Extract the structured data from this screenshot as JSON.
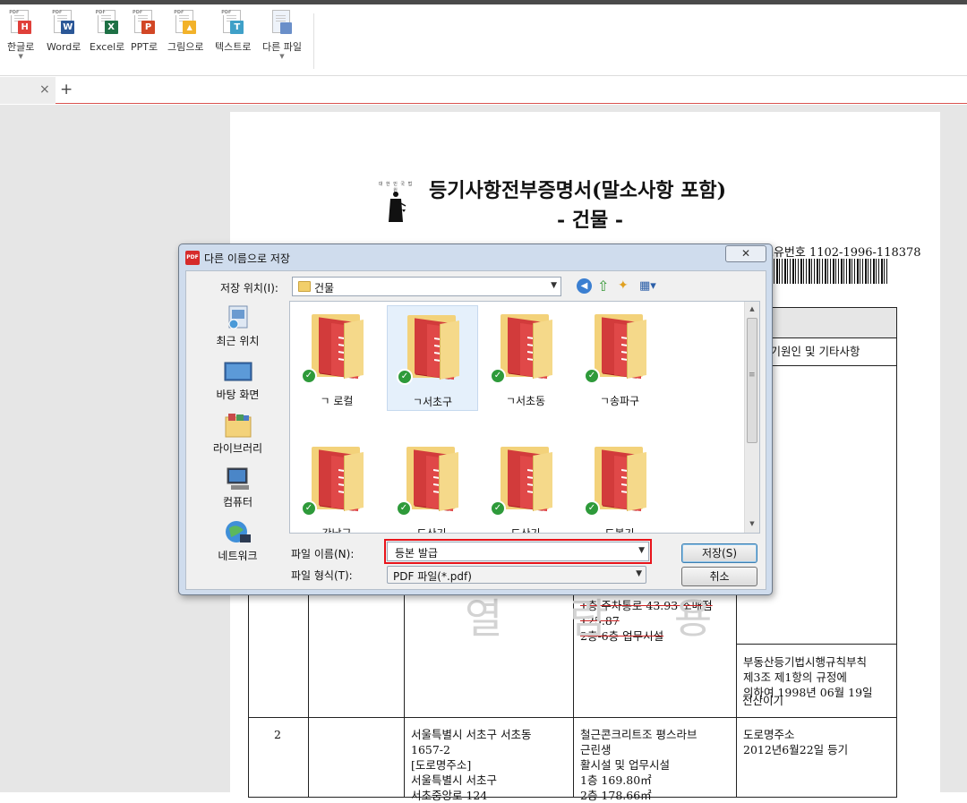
{
  "toolbar": {
    "items": [
      {
        "label": "한글로",
        "badge": "H",
        "color": "#e0403a",
        "has_dropdown": true
      },
      {
        "label": "Word로",
        "badge": "W",
        "color": "#2b5797",
        "has_dropdown": false
      },
      {
        "label": "Excel로",
        "badge": "X",
        "color": "#1e7145",
        "has_dropdown": false
      },
      {
        "label": "PPT로",
        "badge": "P",
        "color": "#d24726",
        "has_dropdown": false
      },
      {
        "label": "그림으로",
        "badge": "▲",
        "color": "#f2b22a",
        "has_dropdown": false
      },
      {
        "label": "텍스트로",
        "badge": "T",
        "color": "#3fa0c8",
        "has_dropdown": false
      },
      {
        "label": "다른 파일",
        "badge": "",
        "color": "#6a8fc9",
        "has_dropdown": true
      }
    ],
    "pdf_tag": "PDF"
  },
  "tabs": {
    "close": "×",
    "add": "+"
  },
  "document": {
    "emblem_text": "대 한 민 국 법 원",
    "title": "등기사항전부증명서(말소사항 포함)",
    "subtitle": "- 건물 -",
    "reg_number": "고유번호 1102-1996-118378",
    "watermark": "열 람 용",
    "table": {
      "header_right": "등기원인 및 기타사항",
      "row1_detail": [
        "1층 주차통로 43.93 소매점",
        "125.87",
        "2층-6층 업무시설"
      ],
      "row1_note": [
        "부동산등기법시행규칙부칙",
        "제3조 제1항의 규정에",
        "의하여   1998년 06월 19일",
        "전산이기"
      ],
      "row2_num": "2",
      "row2_address": [
        "서울특별시 서초구 서초동",
        "1657-2",
        "[도로명주소]",
        "서울특별시 서초구",
        "서초중앙로 124"
      ],
      "row2_detail": [
        "철근콘크리트조 평스라브",
        "근린생",
        "활시설 및 업무시설",
        "1층  169.80㎡",
        "2층 178.66㎡"
      ],
      "row2_note": [
        "도로명주소",
        "2012년6월22일   등기"
      ]
    }
  },
  "dialog": {
    "pdf_icon": "PDF",
    "title": "다른 이름으로 저장",
    "close": "✕",
    "location_label": "저장 위치(I):",
    "location_value": "건물",
    "places": [
      {
        "label": "최근 위치"
      },
      {
        "label": "바탕 화면"
      },
      {
        "label": "라이브러리"
      },
      {
        "label": "컴퓨터"
      },
      {
        "label": "네트워크"
      }
    ],
    "folders": [
      {
        "name": "ㄱ 로컬"
      },
      {
        "name": "ㄱ서초구"
      },
      {
        "name": "ㄱ서초동"
      },
      {
        "name": "ㄱ송파구"
      },
      {
        "name": "강남구"
      },
      {
        "name": "도산기"
      },
      {
        "name": "도산기"
      },
      {
        "name": "도봉기"
      }
    ],
    "filename_label": "파일 이름(N):",
    "filename_value": "등본 발급",
    "filetype_label": "파일 형식(T):",
    "filetype_value": "PDF 파일(*.pdf)",
    "save_label": "저장(S)",
    "cancel_label": "취소"
  }
}
